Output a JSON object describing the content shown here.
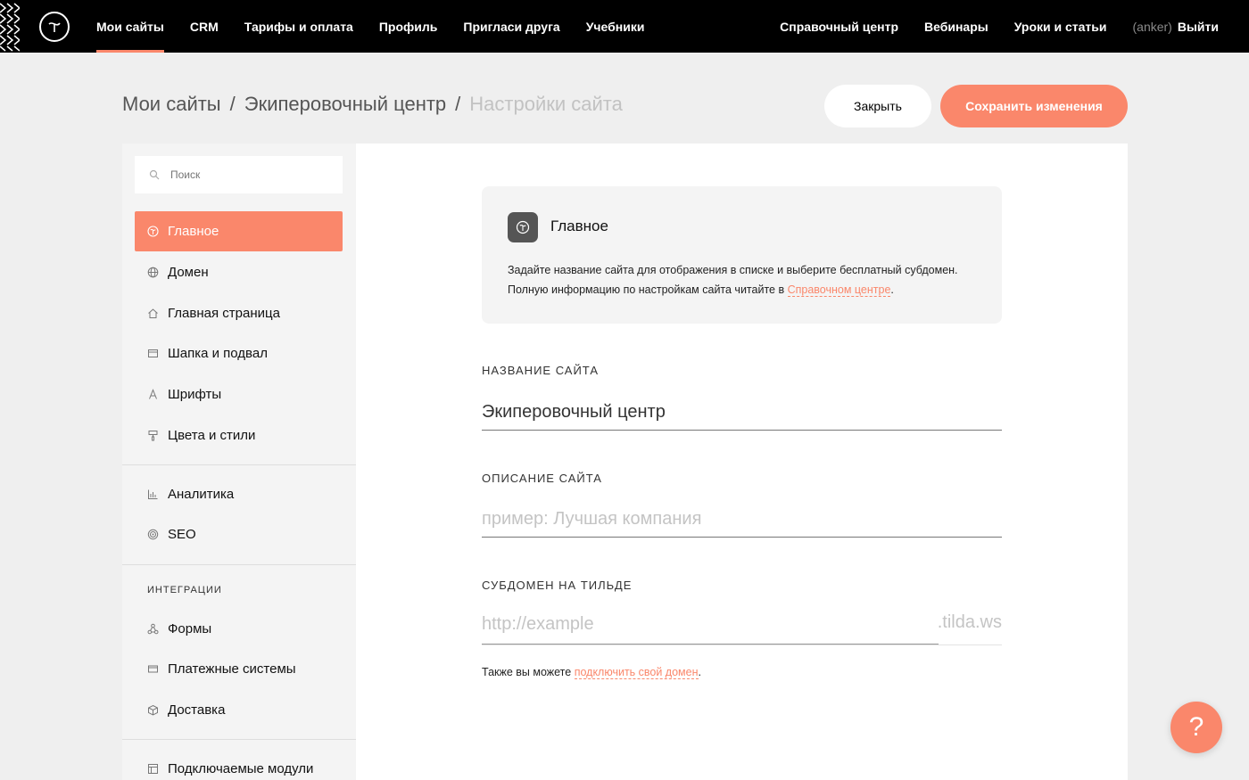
{
  "topbar": {
    "left_nav": [
      "Мои сайты",
      "CRM",
      "Тарифы и оплата",
      "Профиль",
      "Пригласи друга",
      "Учебники"
    ],
    "right_nav": [
      "Справочный центр",
      "Вебинары",
      "Уроки и статьи"
    ],
    "user_handle": "(anker)",
    "logout": "Выйти"
  },
  "breadcrumb": {
    "root": "Мои сайты",
    "sep1": "/",
    "site": "Экиперовочный центр",
    "sep2": "/",
    "current": "Настройки сайта"
  },
  "actions": {
    "close": "Закрыть",
    "save": "Сохранить изменения"
  },
  "sidebar": {
    "search_placeholder": "Поиск",
    "items": [
      {
        "label": "Главное",
        "icon": "tilda-logo-icon"
      },
      {
        "label": "Домен",
        "icon": "globe-icon"
      },
      {
        "label": "Главная страница",
        "icon": "home-icon"
      },
      {
        "label": "Шапка и подвал",
        "icon": "layout-icon"
      },
      {
        "label": "Шрифты",
        "icon": "font-icon"
      },
      {
        "label": "Цвета и стили",
        "icon": "paint-roller-icon"
      },
      {
        "label": "Аналитика",
        "icon": "bar-chart-icon"
      },
      {
        "label": "SEO",
        "icon": "target-icon"
      },
      {
        "label": "Формы",
        "icon": "forms-icon"
      },
      {
        "label": "Платежные системы",
        "icon": "card-icon"
      },
      {
        "label": "Доставка",
        "icon": "box-icon"
      },
      {
        "label": "Подключаемые модули",
        "icon": "modules-icon"
      }
    ],
    "section_integrations": "ИНТЕГРАЦИИ"
  },
  "info": {
    "title": "Главное",
    "text_line1": "Задайте название сайта для отображения в списке и выберите бесплатный субдомен.",
    "text_line2_prefix": "Полную информацию по настройкам сайта читайте в ",
    "text_link": "Справочном центре",
    "text_line2_suffix": "."
  },
  "fields": {
    "site_name_label": "НАЗВАНИЕ САЙТА",
    "site_name_value": "Экиперовочный центр",
    "site_desc_label": "ОПИСАНИЕ САЙТА",
    "site_desc_placeholder": "пример: Лучшая компания",
    "subdomain_label": "СУБДОМЕН НА ТИЛЬДЕ",
    "subdomain_placeholder": "http://example",
    "subdomain_suffix": ".tilda.ws"
  },
  "note": {
    "prefix": "Также вы можете ",
    "link": "подключить свой домен",
    "suffix": "."
  },
  "help_button": "?",
  "colors": {
    "accent": "#fa876b",
    "topbar": "#000000",
    "background": "#efefef"
  }
}
